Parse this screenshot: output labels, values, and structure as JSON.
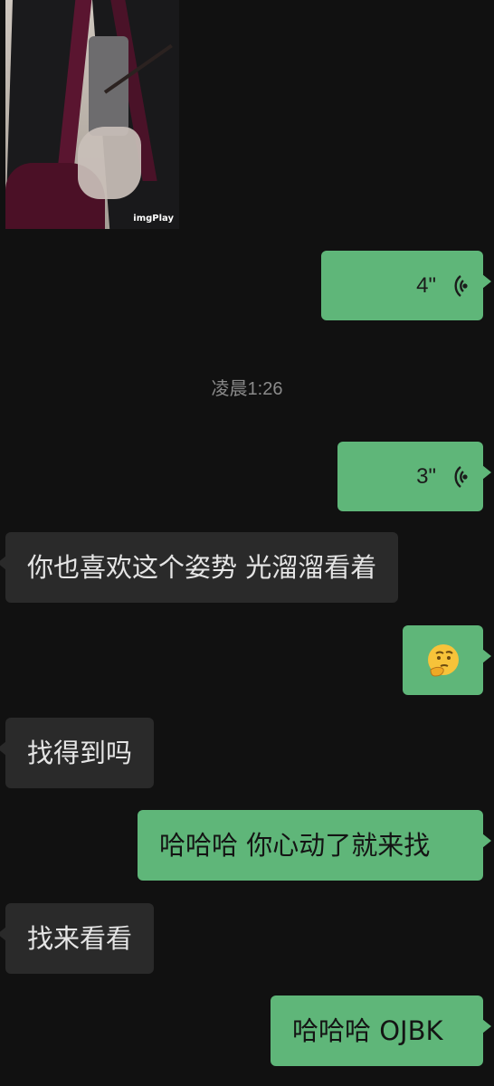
{
  "media": {
    "watermark": "imgPlay"
  },
  "time_divider": "凌晨1:26",
  "messages": [
    {
      "side": "out",
      "type": "voice",
      "duration": "4\""
    },
    {
      "side": "out",
      "type": "voice",
      "duration": "3\""
    },
    {
      "side": "in",
      "type": "text",
      "text": "你也喜欢这个姿势 光溜溜看着"
    },
    {
      "side": "out",
      "type": "emoji",
      "icon": "thinking-face-icon"
    },
    {
      "side": "in",
      "type": "text",
      "text": "找得到吗"
    },
    {
      "side": "out",
      "type": "text",
      "text": "哈哈哈 你心动了就来找"
    },
    {
      "side": "in",
      "type": "text",
      "text": "找来看看"
    },
    {
      "side": "out",
      "type": "text",
      "text": "哈哈哈 OJBK"
    }
  ],
  "colors": {
    "background": "#111111",
    "outgoing_bubble": "#5fb679",
    "incoming_bubble": "#2a2a2a",
    "timestamp": "#8a8a8a"
  }
}
